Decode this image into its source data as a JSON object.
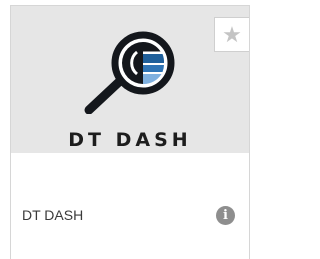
{
  "card": {
    "logo_text": "DT DASH",
    "title": "DT DASH",
    "favorite_icon": "star-icon",
    "info_icon": "info-icon",
    "colors": {
      "image_background": "#e6e6e6",
      "logo_dark": "#14171c",
      "logo_blue": "#1f5f9a",
      "logo_light_blue": "#7fb0df",
      "info_icon": "#8e8e8e"
    }
  }
}
